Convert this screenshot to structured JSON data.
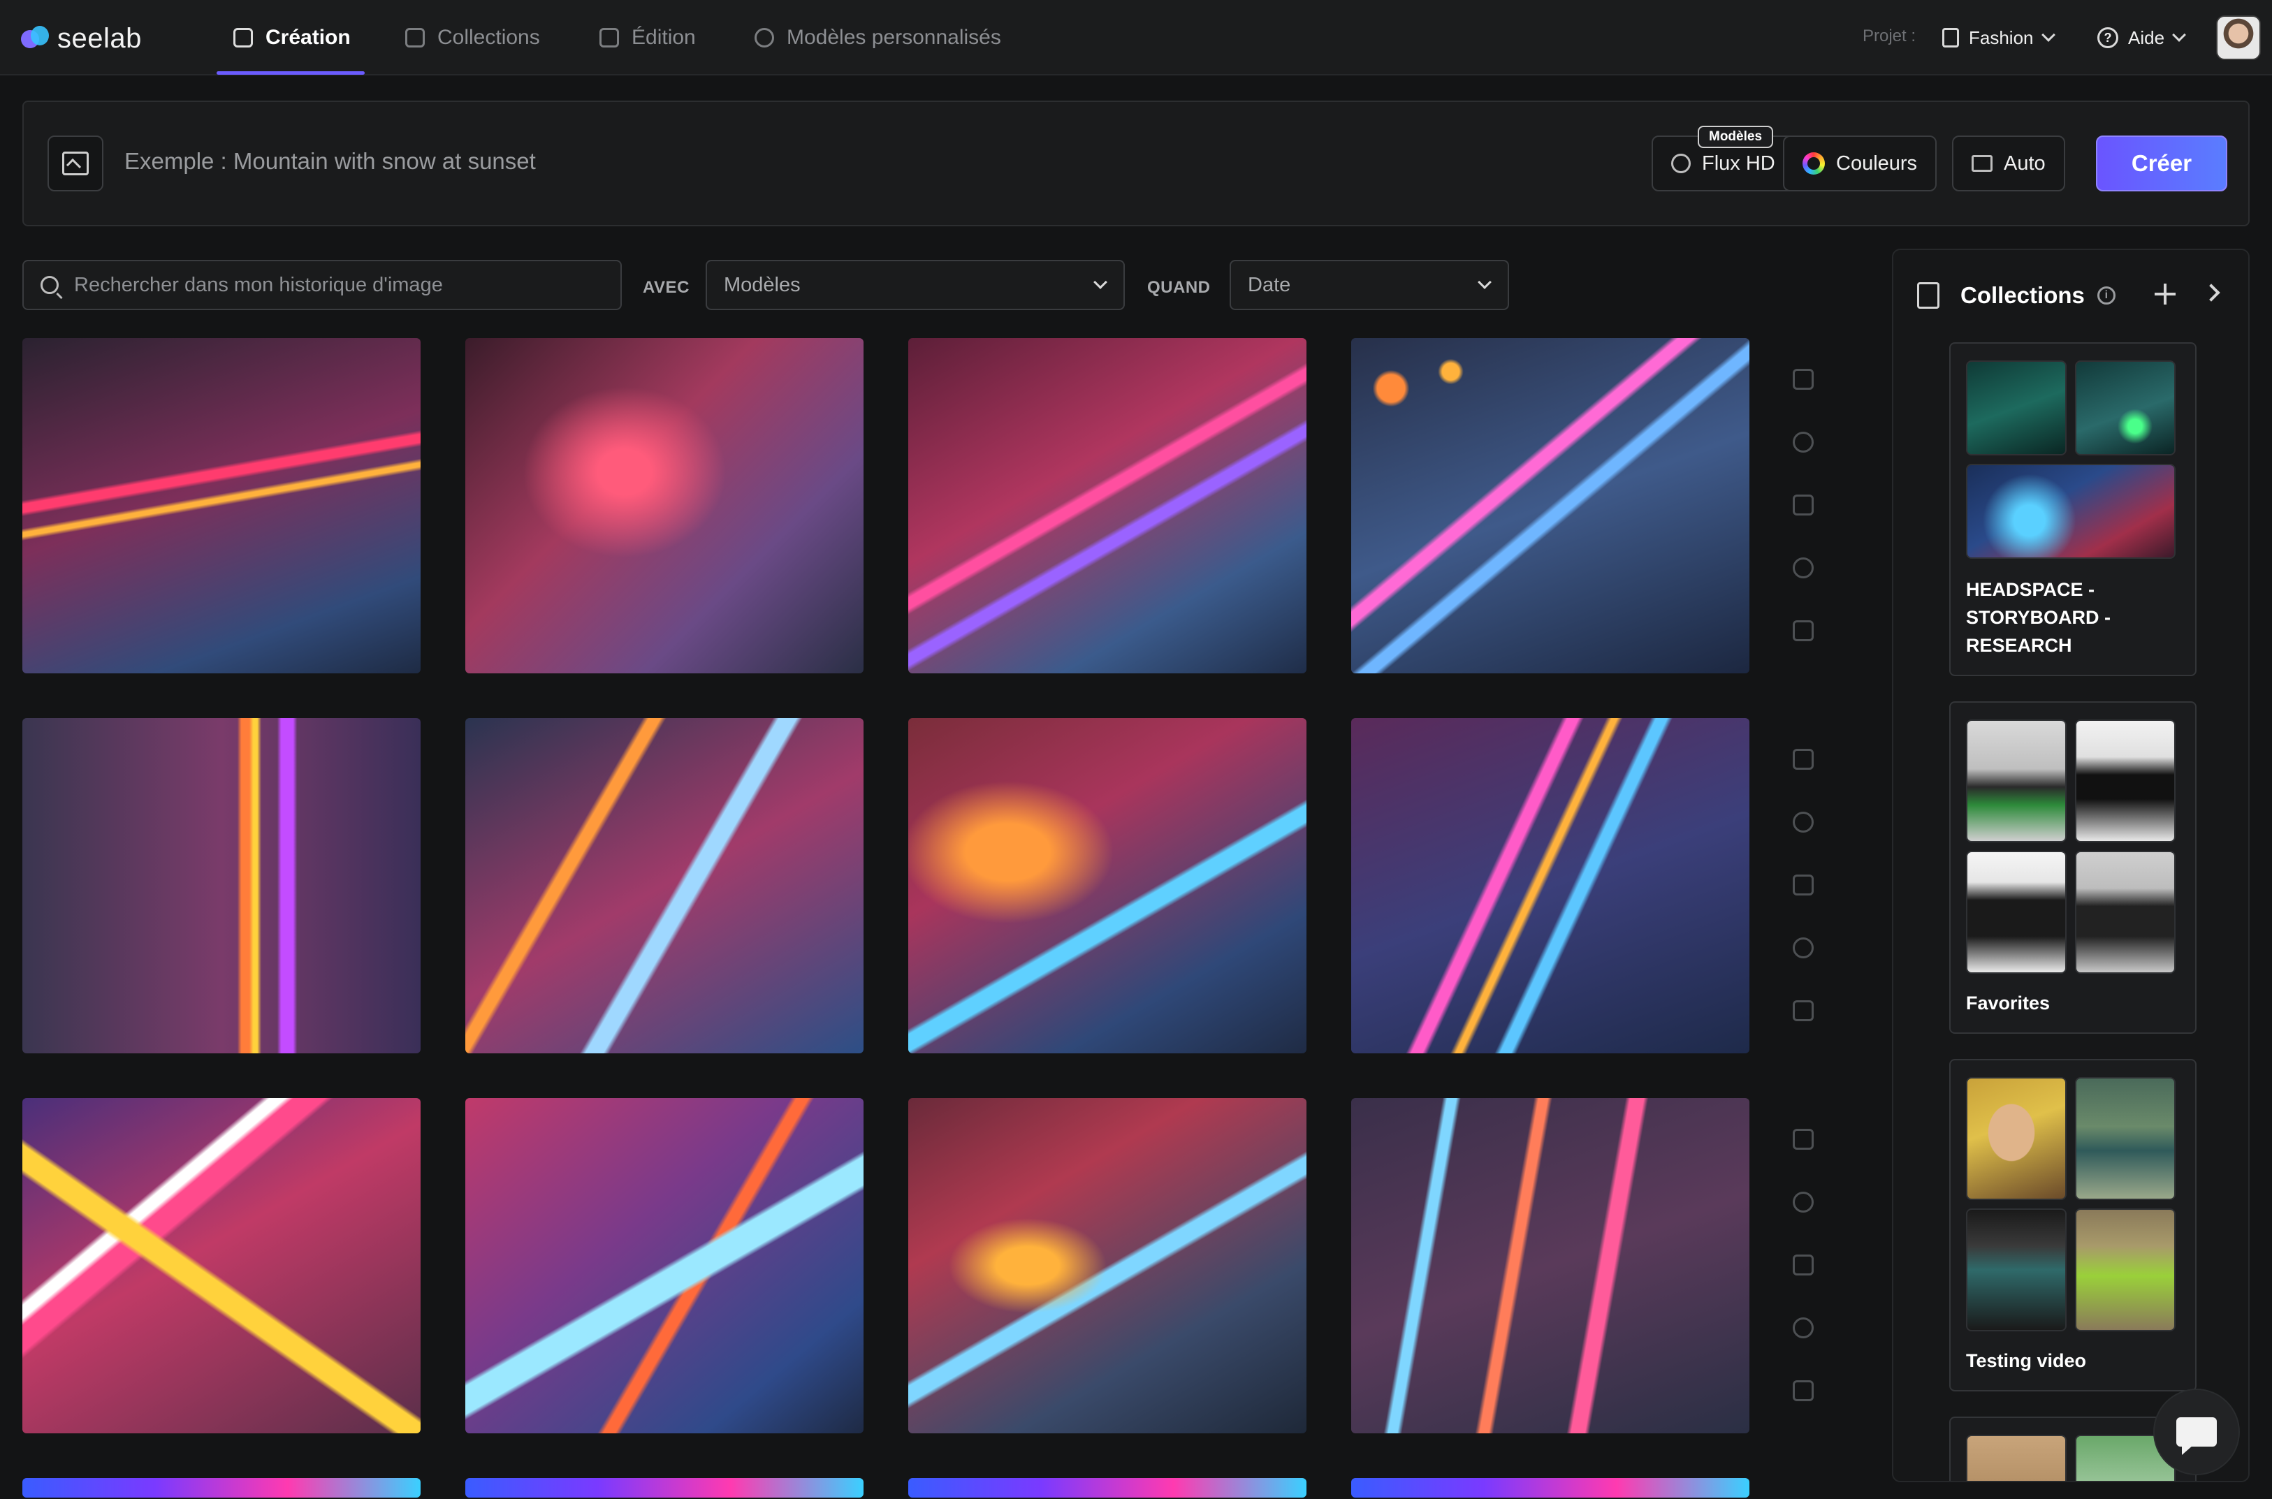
{
  "app": {
    "name": "seelab",
    "colors": {
      "accent": "#6b5cff",
      "accent2": "#5a7dff",
      "background": "#131415"
    }
  },
  "nav": {
    "tabs": [
      {
        "label": "Création",
        "icon": "image-edit-icon",
        "active": true
      },
      {
        "label": "Collections",
        "icon": "collections-icon",
        "active": false
      },
      {
        "label": "Édition",
        "icon": "magic-edit-icon",
        "active": false
      },
      {
        "label": "Modèles personnalisés",
        "icon": "fingerprint-icon",
        "active": false
      }
    ],
    "project_label": "Projet :",
    "project_value": "Fashion",
    "help_label": "Aide"
  },
  "prompt": {
    "placeholder": "Exemple : Mountain with snow at sunset",
    "models_badge": "Modèles",
    "model_button": "Flux HD",
    "colors_button": "Couleurs",
    "ratio_button": "Auto",
    "create_button": "Créer"
  },
  "filters": {
    "search_placeholder": "Rechercher dans mon historique d'image",
    "with_label": "AVEC",
    "models_select": "Modèles",
    "when_label": "QUAND",
    "date_select": "Date"
  },
  "gallery": {
    "row_tools": [
      "timer-icon",
      "fingerprint-icon",
      "clipboard-icon",
      "mask-icon",
      "trash-icon"
    ]
  },
  "collections_panel": {
    "title": "Collections",
    "items": [
      {
        "name": "HEADSPACE - STORYBOARD - RESEARCH"
      },
      {
        "name": "Favorites"
      },
      {
        "name": "Testing video"
      }
    ]
  }
}
